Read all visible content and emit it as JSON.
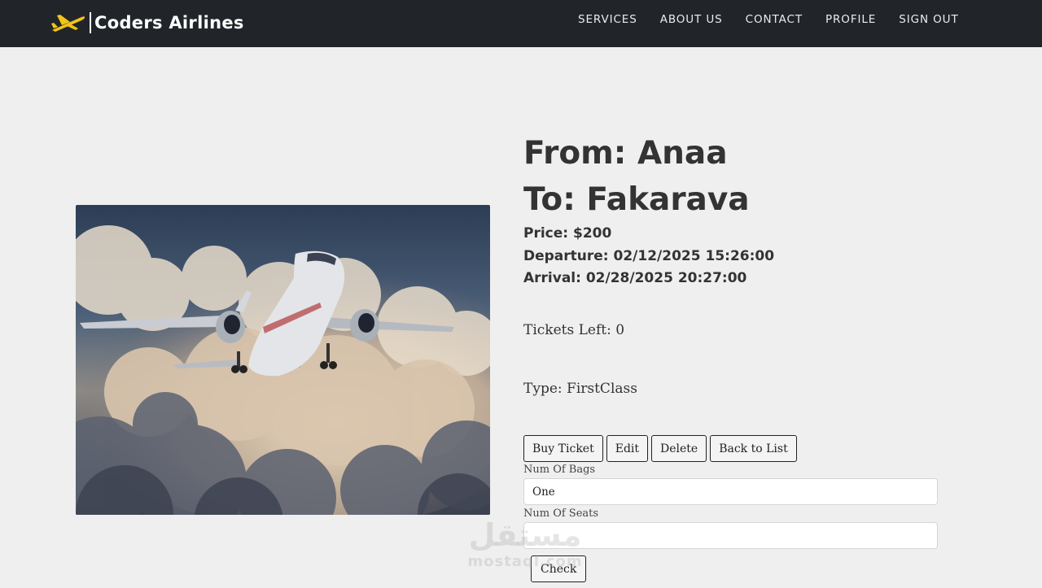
{
  "brand": {
    "name": "Coders Airlines",
    "icon": "plane-logo-icon"
  },
  "nav": {
    "links": [
      "SERVICES",
      "ABOUT US",
      "CONTACT",
      "PROFILE",
      "SIGN OUT"
    ]
  },
  "flight": {
    "from": "From: Anaa",
    "to": "To: Fakarava",
    "price": "Price: $200",
    "departure": "Departure: 02/12/2025 15:26:00",
    "arrival": "Arrival: 02/28/2025 20:27:00",
    "tickets_left": "Tickets Left: 0",
    "type": "Type: FirstClass"
  },
  "actions": {
    "buy": "Buy Ticket",
    "edit": "Edit",
    "delete": "Delete",
    "back": "Back to List"
  },
  "form": {
    "bags_label": "Num Of Bags",
    "bags_value": "One",
    "seats_label": "Num Of Seats",
    "seats_value": "",
    "check": "Check"
  },
  "watermark": {
    "arabic": "مستقل",
    "latin": "mostaql.com"
  },
  "colors": {
    "navbar": "#212529",
    "background": "#efefef",
    "logo": "#f0c419"
  }
}
